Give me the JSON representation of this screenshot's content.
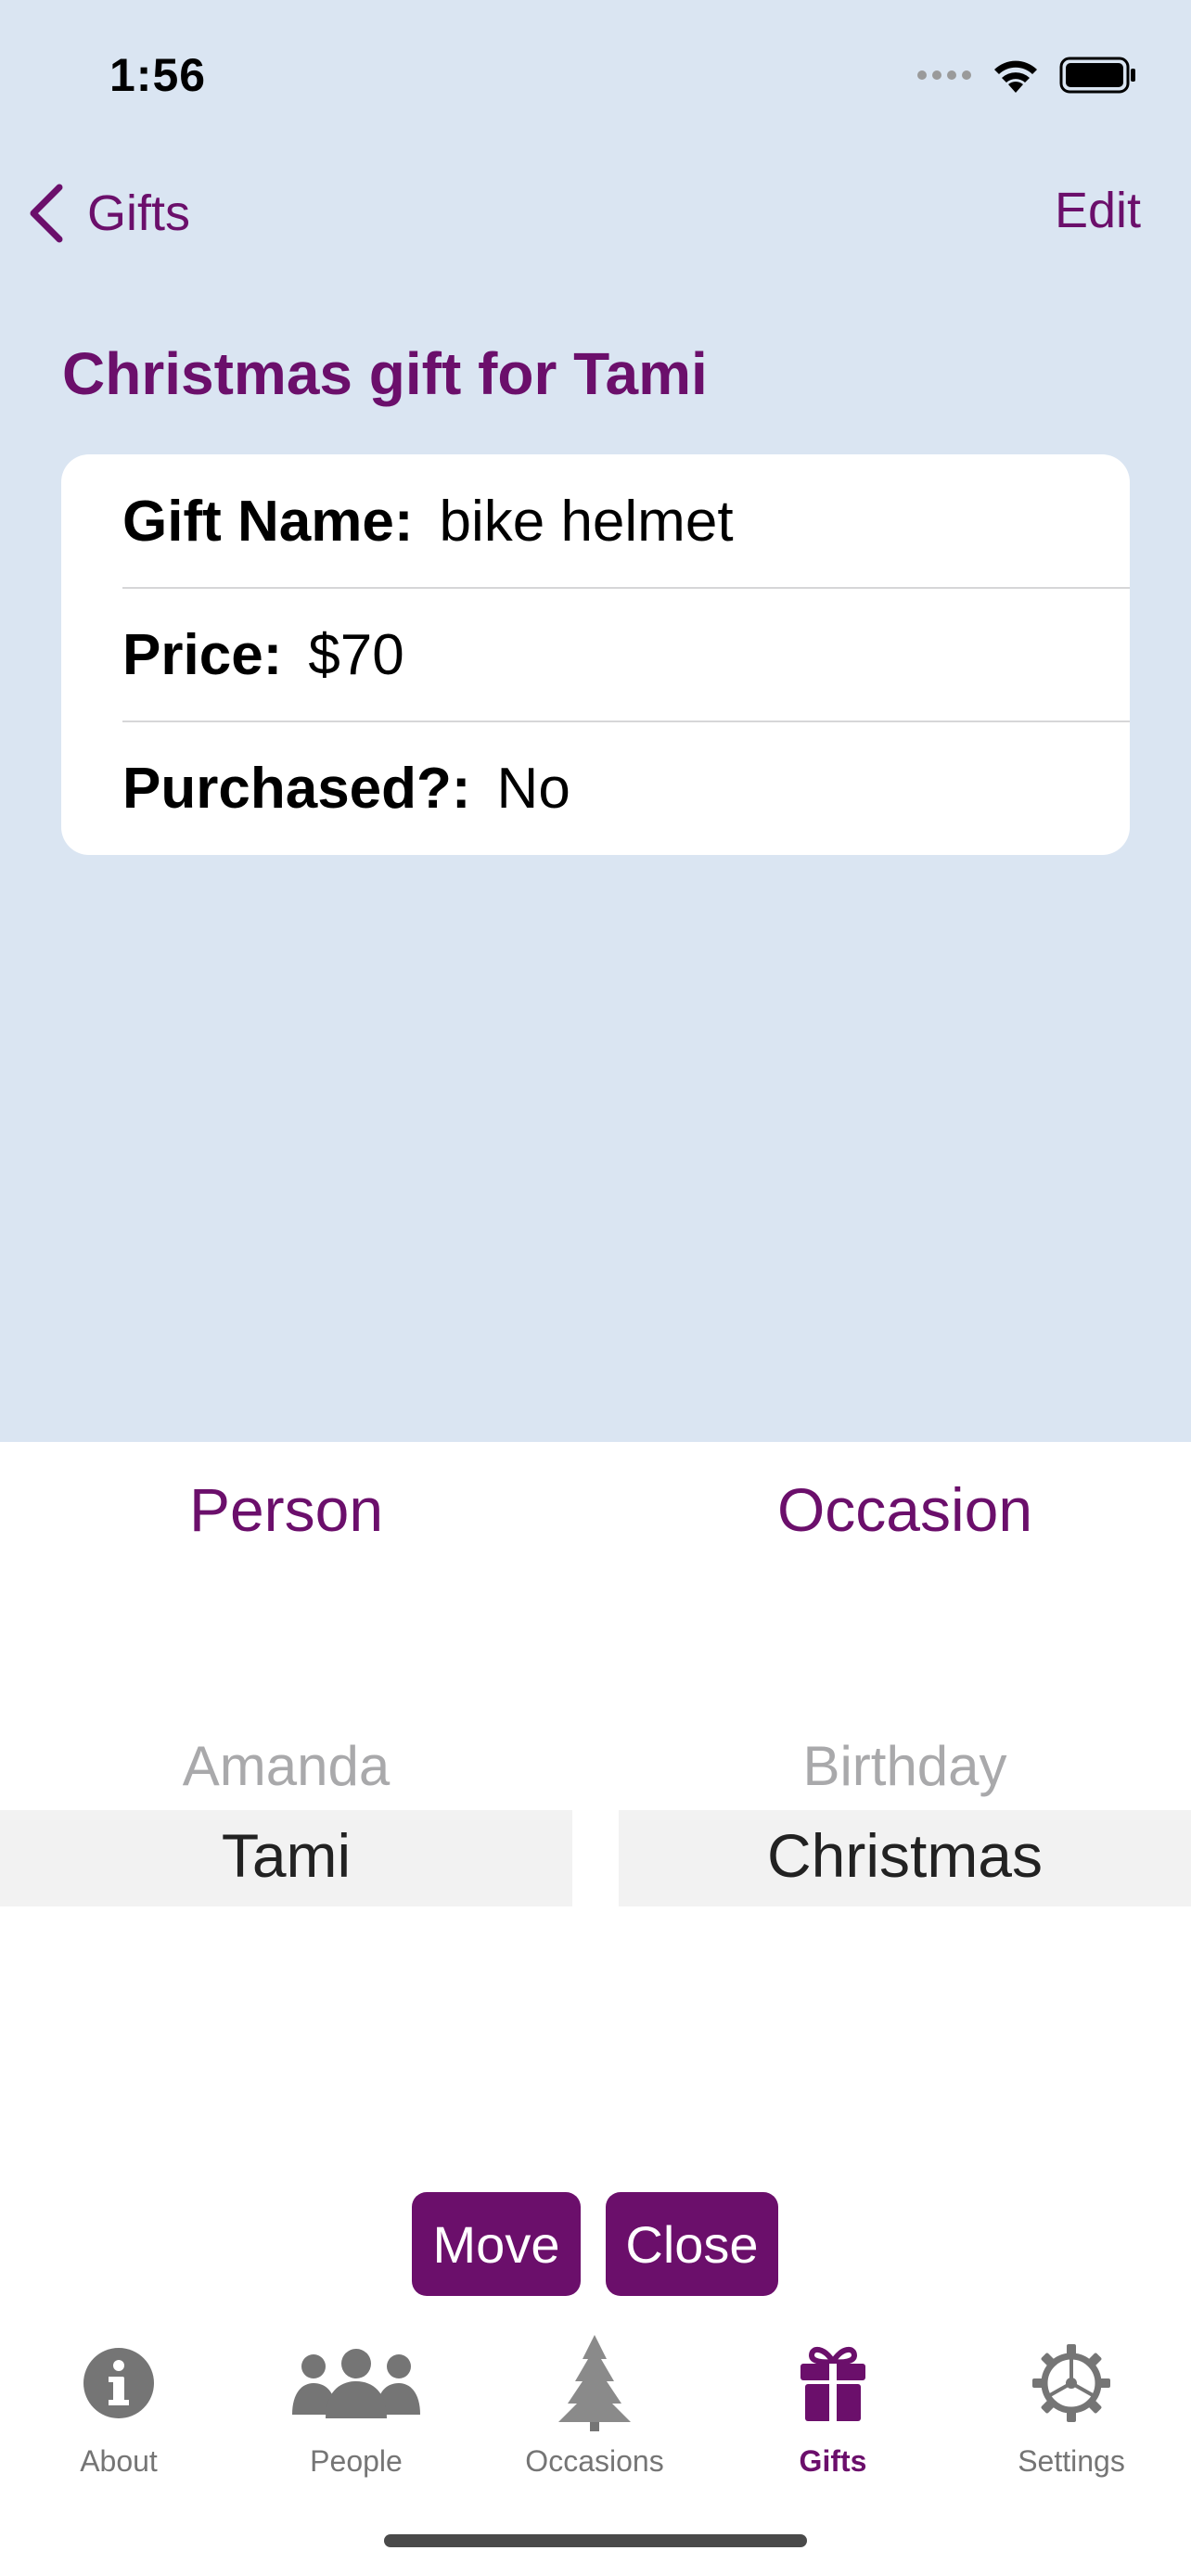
{
  "status": {
    "time": "1:56"
  },
  "nav": {
    "back_label": "Gifts",
    "edit_label": "Edit"
  },
  "page": {
    "title": "Christmas gift for Tami"
  },
  "details": {
    "gift_name": {
      "label": "Gift Name:",
      "value": "bike helmet"
    },
    "price": {
      "label": "Price:",
      "value": "$70"
    },
    "purchased": {
      "label": "Purchased?:",
      "value": "No"
    }
  },
  "picker": {
    "person": {
      "header": "Person",
      "dim": "Amanda",
      "selected": "Tami"
    },
    "occasion": {
      "header": "Occasion",
      "dim": "Birthday",
      "selected": "Christmas"
    }
  },
  "actions": {
    "move_label": "Move",
    "close_label": "Close"
  },
  "tabs": [
    {
      "label": "About",
      "icon": "info-icon"
    },
    {
      "label": "People",
      "icon": "people-icon"
    },
    {
      "label": "Occasions",
      "icon": "tree-icon"
    },
    {
      "label": "Gifts",
      "icon": "gift-icon",
      "active": true
    },
    {
      "label": "Settings",
      "icon": "gear-icon"
    }
  ],
  "colors": {
    "accent": "#6b0f6b",
    "background": "#dae5f2",
    "inactive": "#757575"
  }
}
